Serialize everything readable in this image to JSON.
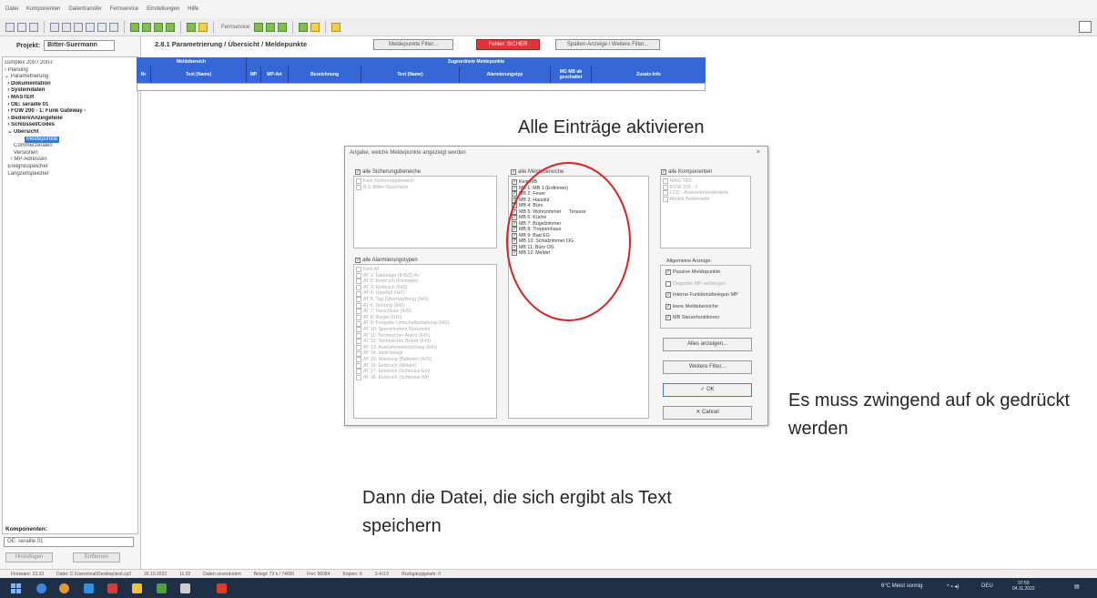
{
  "menu": [
    "Datei",
    "Komponenten",
    "Datentransfer",
    "Fernservice",
    "Einstellungen",
    "Hilfe"
  ],
  "toolbar": {
    "fernservice_label": "Fernservice"
  },
  "project": {
    "label": "Projekt:",
    "name": "Bitter-Suermann"
  },
  "tree": [
    {
      "text": "complex 200 / 200-I",
      "cls": ""
    },
    {
      "text": "› Planung",
      "cls": ""
    },
    {
      "text": "⌄ Parametrierung",
      "cls": ""
    },
    {
      "text": "  › Dokumentation",
      "cls": "b"
    },
    {
      "text": "  › Systemdaten",
      "cls": "b"
    },
    {
      "text": "  › MASTER",
      "cls": "b"
    },
    {
      "text": "  › OE: seraille 01",
      "cls": "b"
    },
    {
      "text": "  › FGW 200 - 1: Funk Gateway -",
      "cls": "b"
    },
    {
      "text": "  › Bedien/Anzeigeteile",
      "cls": "b"
    },
    {
      "text": "  › Schlüssel/Codes",
      "cls": "b"
    },
    {
      "text": "  ⌄ Übersicht",
      "cls": "b"
    },
    {
      "text": "Meldepunkte",
      "cls": "sel"
    },
    {
      "text": "      Commerzeralen",
      "cls": ""
    },
    {
      "text": "      Versionen",
      "cls": ""
    },
    {
      "text": "    › MP-Adressen",
      "cls": ""
    },
    {
      "text": "  Ereignisspeicher",
      "cls": ""
    },
    {
      "text": "  Langzeitspeicher",
      "cls": ""
    }
  ],
  "components": {
    "label": "Komponenten:",
    "selected": "OE: seraille 01",
    "btn_add": "Hinzufügen",
    "btn_remove": "Entfernen"
  },
  "content": {
    "title": "2.8.1  Parametrierung / Übersicht / Meldepunkte",
    "btn_filter": "Meldepunkte Filter...",
    "btn_error": "Fehler: SICHER",
    "btn_columns": "Spalten-Anzeige / Weitere Filter..."
  },
  "table": {
    "group_left": "Meldebereich",
    "group_right": "Zugeordnete Meldepunkte",
    "columns": [
      "Nr",
      "Text (Name)",
      "MP",
      "MP-Art",
      "Bezeichnung",
      "Text (Name)",
      "Alarmierungstyp",
      "MG MB ab geschaltet",
      "Zusatz-Info"
    ]
  },
  "dialog": {
    "title": "Angabe, welche Meldepunkte angezeigt werden",
    "close": "×",
    "sicherung": {
      "head": "alle Sicherungsbereiche",
      "items": [
        "Kein Sicherungsbereich",
        "B 1: Bitter-Suermann"
      ]
    },
    "alarm": {
      "head": "alle Alarmierungstypen",
      "items": [
        "Kein AT",
        "AT 1: Sabotage (IHS/Z) Al",
        "AT 2: Einbruch (Kontakte)",
        "AT 3: Einbruch (IHS)",
        "AT 4: Überfall (IHS)",
        "AT 5: Tag (Überwachung (IHS)",
        "AT 6: Störung (IHS)",
        "AT 7: Verschluss (IHS)",
        "AT 8: Riegel (IHS)",
        "AT 9: Freigabe Umschaltschaltung (IHS)",
        "AT 10: Sperrelement Rückmeld",
        "AT 11: Technischer Alarm (IHS)",
        "AT 12: Technischer Brand (IHS)",
        "AT 13: Ausnahmeeinrichtung (IHS)",
        "AT 14: nicht belegt",
        "AT 15: Warnung (Batterie) (IHS)",
        "AT 16: Einbruch (Melder)",
        "AT 17: Einbruch (Schleuse Ein)",
        "AT 18: Einbruch (Schleuse Wt)"
      ]
    },
    "melde": {
      "head": "alle Meldebereiche",
      "items": [
        "Kein MB",
        "MB 1: MB 1 (Erdinnen)",
        "MB 2: Feuer",
        "MB 3: Haustür",
        "MB 4: Büro",
        "MB 5: Wohnzimmer      Terasse",
        "MB 6: Küche",
        "MB 7: Bügelzimmer",
        "MB 8: Treppenhaus",
        "MB 9: Bad EG",
        "MB 10: Schlafzimmer OG",
        "MB 11: Büro OG",
        "MB 12: Melder"
      ]
    },
    "komponenten": {
      "head": "alle Komponenten",
      "items": [
        "MAG TER",
        "FGW 200 - 1",
        "LCD - Anwenderbedienteile",
        "Mobile Bedienteile"
      ]
    },
    "anzeige": {
      "head": "Allgemeine Anzeige:",
      "options": [
        {
          "label": "Passive Meldepunkte",
          "checked": true
        },
        {
          "label": "Doppelte MP verbergen",
          "checked": false
        },
        {
          "label": "Interne Funktionsbelegun MP",
          "checked": true
        },
        {
          "label": "leere Meldebereiche",
          "checked": true
        },
        {
          "label": "MB Steuerfunktionen",
          "checked": true
        }
      ]
    },
    "btn_all": "Alles anzeigen...",
    "btn_more": "Weitere Filter...",
    "btn_ok": "✓  OK",
    "btn_cancel": "✕  Cancel"
  },
  "callouts": {
    "activate": "Alle Einträge aktivieren",
    "ok": "Es muss zwingend auf ok gedrückt werden",
    "save": "Dann die Datei, die sich ergibt als Text speichern"
  },
  "statusbar": [
    "Firmware: 23.33",
    "Datei: C:\\Users\\mal\\Desktop\\test.cp2",
    "26.10.2022",
    "11:32",
    "Daten unverändert",
    "Belegt: 73 k / 74000",
    "Frei: 56084",
    "Kopien: 0",
    "1-4.0.0",
    "Rückgängigstufe: 0"
  ],
  "taskbar": {
    "weather": "6°C  Meist sonnig",
    "clock": "07:59",
    "date": "04.11.2022",
    "lang": "DEU"
  }
}
